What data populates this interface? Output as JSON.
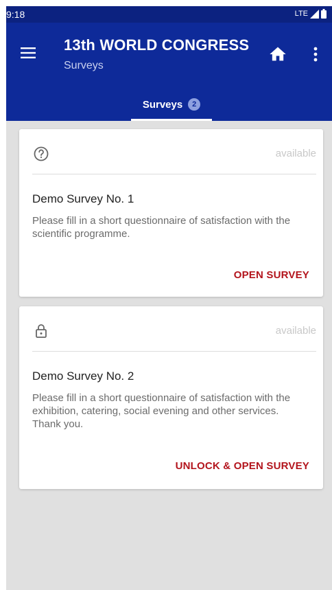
{
  "status_bar": {
    "time": "9:18",
    "network": "LTE"
  },
  "app_bar": {
    "title": "13th WORLD CONGRESS",
    "subtitle": "Surveys",
    "menu_icon": "hamburger-menu-icon",
    "home_icon": "home-icon",
    "more_icon": "more-vert-icon"
  },
  "tabs": [
    {
      "label": "Surveys",
      "badge": "2",
      "active": true
    }
  ],
  "surveys": [
    {
      "icon": "help-circle-icon",
      "status": "available",
      "title": "Demo Survey No. 1",
      "description": "Please fill in a short questionnaire of satisfaction with the scientific programme.",
      "action": "OPEN SURVEY"
    },
    {
      "icon": "lock-icon",
      "status": "available",
      "title": "Demo Survey No. 2",
      "description": "Please fill in a short questionnaire of satisfaction with the exhibition, catering, social evening and other services. Thank you.",
      "action": "UNLOCK & OPEN SURVEY"
    }
  ],
  "colors": {
    "app_bar": "#0e2a99",
    "status_bar": "#0c2280",
    "action": "#b3141c",
    "background": "#e0e0e0"
  }
}
